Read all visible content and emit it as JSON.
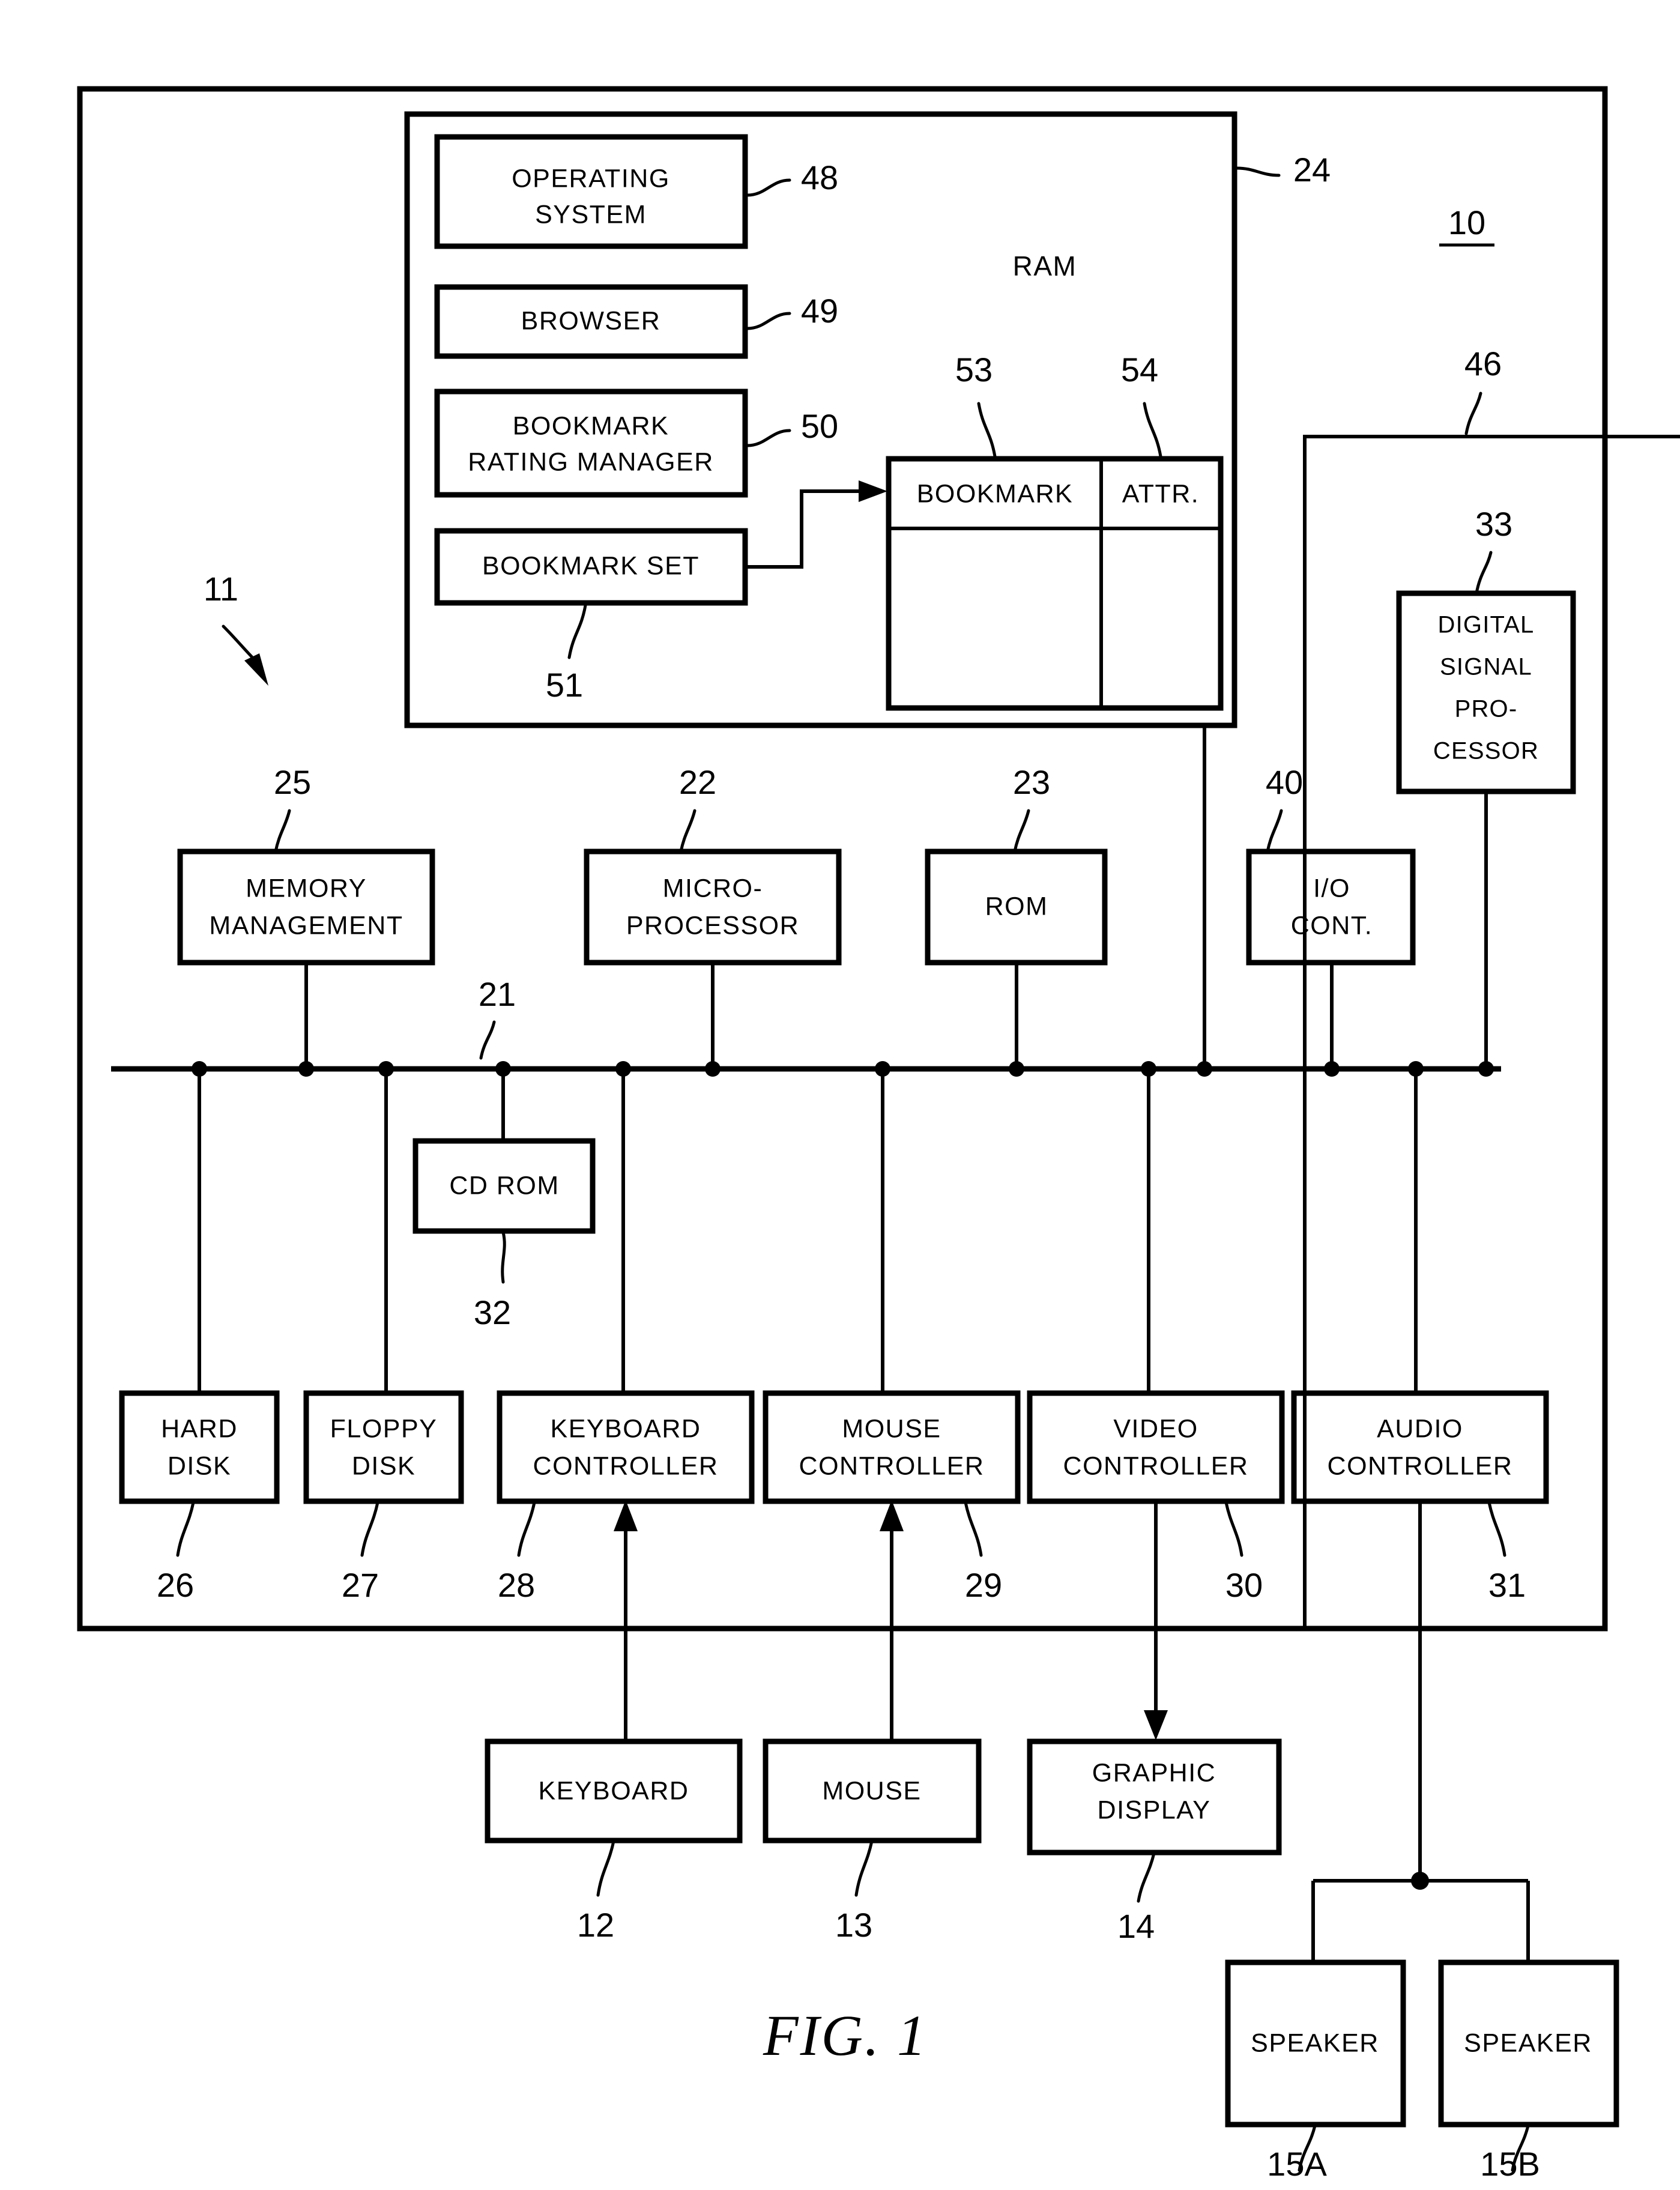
{
  "figure": {
    "caption": "FIG.  1",
    "system_ref": "10",
    "computer_ref": "11"
  },
  "ram_region": {
    "ref": "24",
    "title": "RAM",
    "modules": [
      {
        "label": "OPERATING\nSYSTEM",
        "line1": "OPERATING",
        "line2": "SYSTEM",
        "ref": "48"
      },
      {
        "label": "BROWSER",
        "line1": "BROWSER",
        "line2": "",
        "ref": "49"
      },
      {
        "label": "BOOKMARK\nRATING  MANAGER",
        "line1": "BOOKMARK",
        "line2": "RATING  MANAGER",
        "ref": "50"
      },
      {
        "label": "BOOKMARK SET",
        "line1": "BOOKMARK  SET",
        "line2": "",
        "ref": "51"
      }
    ],
    "table": {
      "columns": [
        {
          "header": "BOOKMARK",
          "ref": "53"
        },
        {
          "header": "ATTR.",
          "ref": "54"
        }
      ],
      "rows": [
        {
          "bookmark": "",
          "attr": ""
        }
      ]
    }
  },
  "bus": {
    "ref": "21"
  },
  "middle_row": [
    {
      "line1": "MEMORY",
      "line2": "MANAGEMENT",
      "ref": "25"
    },
    {
      "line1": "MICRO-",
      "line2": "PROCESSOR",
      "ref": "22"
    },
    {
      "line1": "ROM",
      "line2": "",
      "ref": "23"
    },
    {
      "line1": "I/O",
      "line2": "CONT.",
      "ref": "40"
    }
  ],
  "dsp": {
    "line1": "DIGITAL",
    "line2": "SIGNAL",
    "line3": "PRO-",
    "line4": "CESSOR",
    "ref": "33",
    "link_ref": "46"
  },
  "cd_rom": {
    "label": "CD  ROM",
    "ref": "32"
  },
  "controller_row": [
    {
      "line1": "HARD",
      "line2": "DISK",
      "ref": "26"
    },
    {
      "line1": "FLOPPY",
      "line2": "DISK",
      "ref": "27"
    },
    {
      "line1": "KEYBOARD",
      "line2": "CONTROLLER",
      "ref": "28"
    },
    {
      "line1": "MOUSE",
      "line2": "CONTROLLER",
      "ref": "29"
    },
    {
      "line1": "VIDEO",
      "line2": "CONTROLLER",
      "ref": "30"
    },
    {
      "line1": "AUDIO",
      "line2": "CONTROLLER",
      "ref": "31"
    }
  ],
  "peripherals": [
    {
      "line1": "KEYBOARD",
      "line2": "",
      "ref": "12"
    },
    {
      "line1": "MOUSE",
      "line2": "",
      "ref": "13"
    },
    {
      "line1": "GRAPHIC",
      "line2": "DISPLAY",
      "ref": "14"
    }
  ],
  "speakers": [
    {
      "label": "SPEAKER",
      "ref": "15A"
    },
    {
      "label": "SPEAKER",
      "ref": "15B"
    }
  ],
  "colors": {
    "ink": "#000000",
    "paper": "#ffffff"
  }
}
